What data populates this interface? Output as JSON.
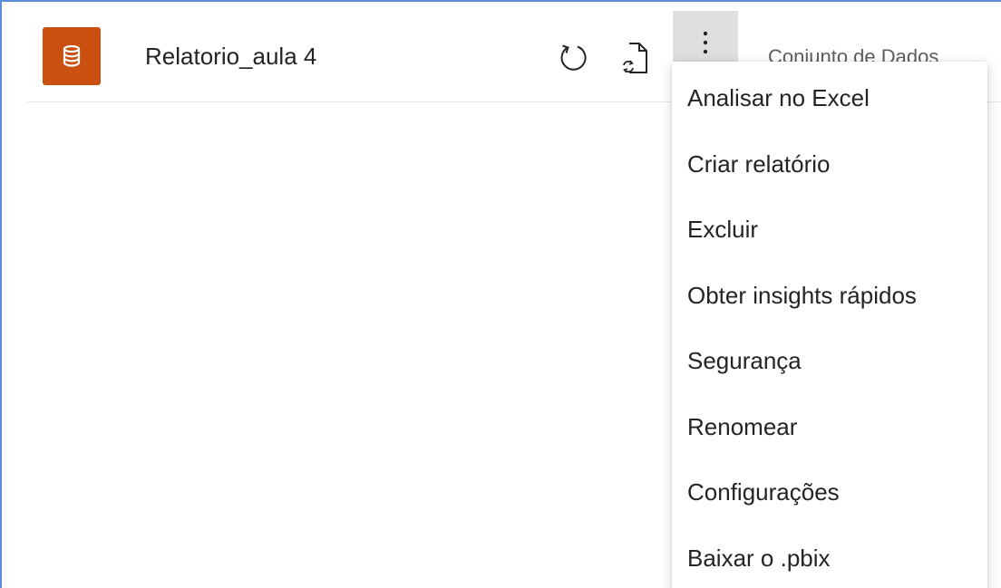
{
  "dataset": {
    "name": "Relatorio_aula 4",
    "type": "Conjunto de Dados",
    "icon": "database-icon",
    "icon_color": "#ca5010"
  },
  "actions": {
    "refresh_icon": "refresh-icon",
    "schedule_icon": "scheduled-refresh-icon",
    "more_icon": "more-options-icon"
  },
  "menu": {
    "items": [
      {
        "label": "Analisar no Excel"
      },
      {
        "label": "Criar relatório"
      },
      {
        "label": "Excluir"
      },
      {
        "label": "Obter insights rápidos"
      },
      {
        "label": "Segurança"
      },
      {
        "label": "Renomear"
      },
      {
        "label": "Configurações"
      },
      {
        "label": "Baixar o .pbix"
      }
    ]
  }
}
